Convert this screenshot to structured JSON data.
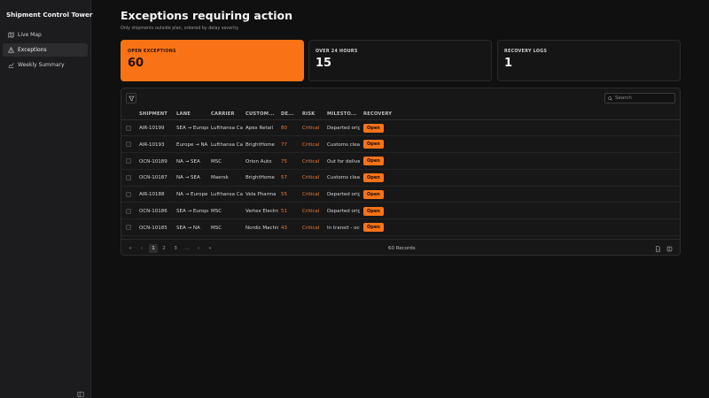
{
  "app": {
    "title": "Shipment Control Tower"
  },
  "sidebar": {
    "items": [
      {
        "label": "Live Map",
        "icon": "map-icon"
      },
      {
        "label": "Exceptions",
        "icon": "warning-icon",
        "active": true
      },
      {
        "label": "Weekly Summary",
        "icon": "chart-icon"
      }
    ]
  },
  "page": {
    "title": "Exceptions requiring action",
    "subtitle": "Only shipments outside plan, ordered by delay severity"
  },
  "cards": [
    {
      "label": "OPEN EXCEPTIONS",
      "value": "60"
    },
    {
      "label": "OVER 24 HOURS",
      "value": "15"
    },
    {
      "label": "RECOVERY LOGS",
      "value": "1"
    }
  ],
  "search": {
    "placeholder": "Search"
  },
  "table": {
    "headers": [
      "SHIPMENT",
      "LANE",
      "CARRIER",
      "CUSTOM...",
      "DE...",
      "RISK",
      "MILESTO...",
      "RECOVERY"
    ],
    "rows": [
      {
        "shipment": "AIR-10199",
        "lane": "SEA → Europe",
        "carrier": "Lufthansa Cargo",
        "customer": "Apex Retail",
        "delay": "80",
        "risk": "Critical",
        "milestone": "Departed origin",
        "recovery": "Open"
      },
      {
        "shipment": "AIR-10193",
        "lane": "Europe → NA",
        "carrier": "Lufthansa Cargo",
        "customer": "BrightHome",
        "delay": "77",
        "risk": "Critical",
        "milestone": "Customs clearance",
        "recovery": "Open"
      },
      {
        "shipment": "OCN-10189",
        "lane": "NA → SEA",
        "carrier": "MSC",
        "customer": "Orion Auto",
        "delay": "75",
        "risk": "Critical",
        "milestone": "Out for delivery",
        "recovery": "Open"
      },
      {
        "shipment": "OCN-10187",
        "lane": "NA → SEA",
        "carrier": "Maersk",
        "customer": "BrightHome",
        "delay": "57",
        "risk": "Critical",
        "milestone": "Customs clearance",
        "recovery": "Open"
      },
      {
        "shipment": "AIR-10188",
        "lane": "NA → Europe",
        "carrier": "Lufthansa Cargo",
        "customer": "Vela Pharma",
        "delay": "55",
        "risk": "Critical",
        "milestone": "Departed origin",
        "recovery": "Open"
      },
      {
        "shipment": "OCN-10186",
        "lane": "SEA → Europe",
        "carrier": "MSC",
        "customer": "Vertex Electronics",
        "delay": "51",
        "risk": "Critical",
        "milestone": "Departed origin",
        "recovery": "Open"
      },
      {
        "shipment": "OCN-10185",
        "lane": "SEA → NA",
        "carrier": "MSC",
        "customer": "Nordic Machines",
        "delay": "43",
        "risk": "Critical",
        "milestone": "In transit - ocean",
        "recovery": "Open"
      }
    ]
  },
  "pagination": {
    "pages": [
      "1",
      "2",
      "3",
      "…"
    ],
    "current": "1",
    "records": "60 Records"
  },
  "colors": {
    "accent": "#f97316",
    "background": "#101010",
    "sidebar": "#1c1c1e"
  }
}
